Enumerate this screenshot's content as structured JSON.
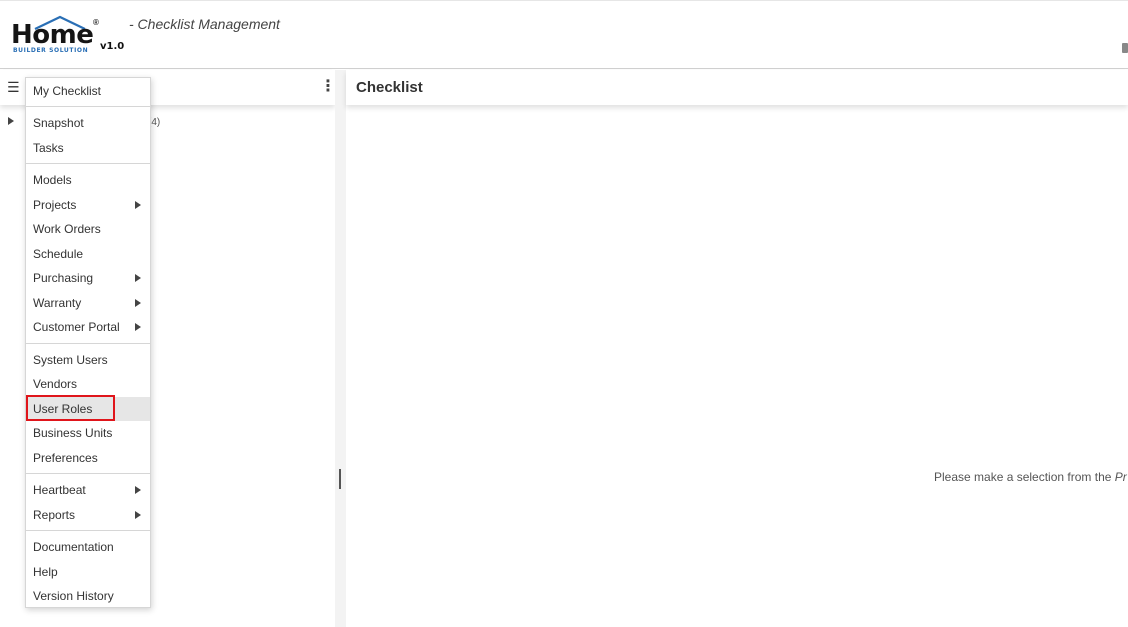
{
  "header": {
    "logo": {
      "word": "Home",
      "registered": "®",
      "subtitle": "BUILDER SOLUTION",
      "version": "v1.0"
    },
    "app_title": "- Checklist Management"
  },
  "left_pane": {
    "toolbar": {
      "menu_icon": "hamburger-icon",
      "more_icon": "kebab-icon"
    },
    "tree_count": "(4)"
  },
  "menu": {
    "items": [
      {
        "label": "My Checklist",
        "has_submenu": false
      },
      {
        "label": "Snapshot",
        "has_submenu": false
      },
      {
        "label": "Tasks",
        "has_submenu": false
      },
      {
        "label": "Models",
        "has_submenu": false
      },
      {
        "label": "Projects",
        "has_submenu": true
      },
      {
        "label": "Work Orders",
        "has_submenu": false
      },
      {
        "label": "Schedule",
        "has_submenu": false
      },
      {
        "label": "Purchasing",
        "has_submenu": true
      },
      {
        "label": "Warranty",
        "has_submenu": true
      },
      {
        "label": "Customer Portal",
        "has_submenu": true
      },
      {
        "label": "System Users",
        "has_submenu": false
      },
      {
        "label": "Vendors",
        "has_submenu": false
      },
      {
        "label": "User Roles",
        "has_submenu": false,
        "selected": true
      },
      {
        "label": "Business Units",
        "has_submenu": false
      },
      {
        "label": "Preferences",
        "has_submenu": false
      },
      {
        "label": "Heartbeat",
        "has_submenu": true
      },
      {
        "label": "Reports",
        "has_submenu": true
      },
      {
        "label": "Documentation",
        "has_submenu": false
      },
      {
        "label": "Help",
        "has_submenu": false
      },
      {
        "label": "Version History",
        "has_submenu": false
      }
    ]
  },
  "right_pane": {
    "title": "Checklist",
    "empty_message": "Please make a selection from the ",
    "empty_message_italic": "Pr"
  },
  "colors": {
    "highlight": "#e0151b",
    "logo_blue": "#2a6fb5",
    "selected_bg": "#e6e6e6"
  }
}
